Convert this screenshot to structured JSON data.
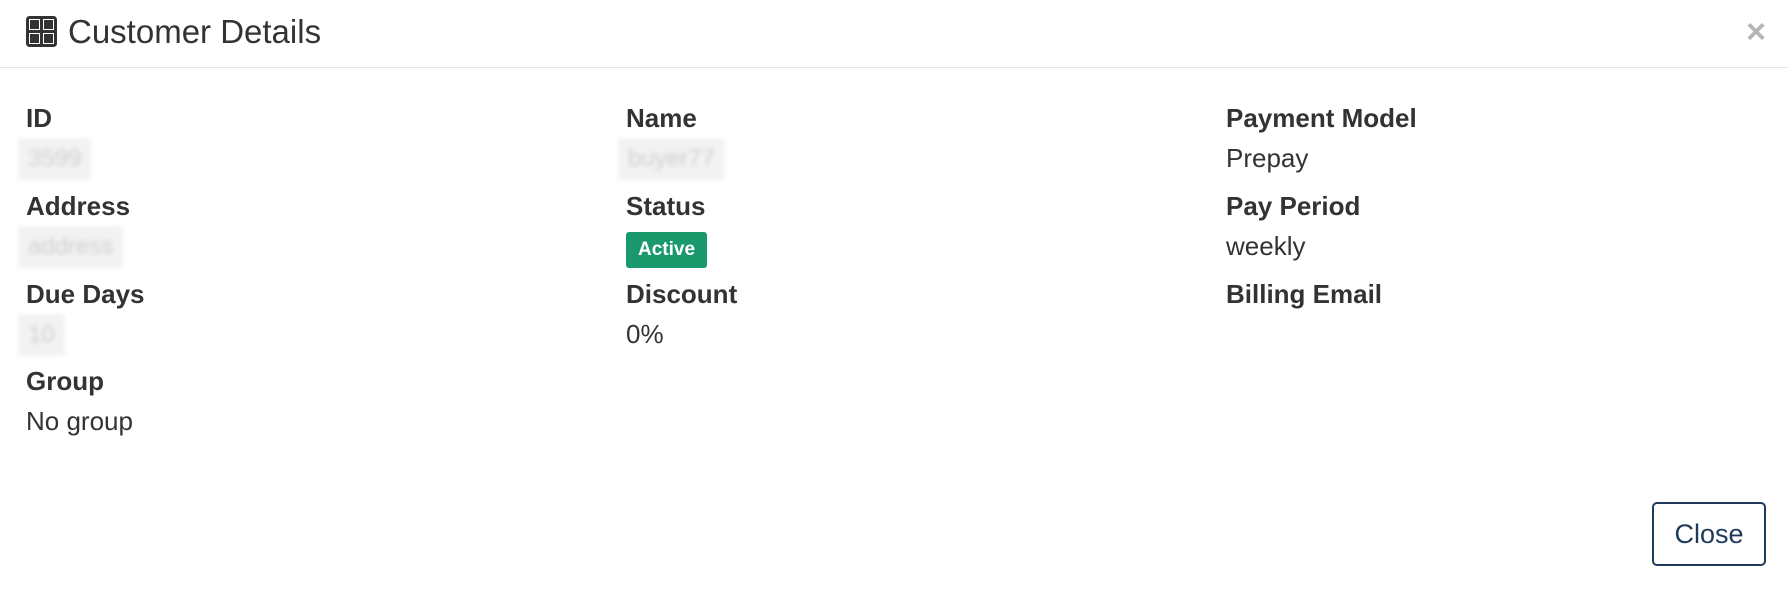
{
  "header": {
    "icon": "grid-icon",
    "title": "Customer Details",
    "close_glyph": "×"
  },
  "fields": {
    "id": {
      "label": "ID",
      "value": "3599"
    },
    "address": {
      "label": "Address",
      "value": "address"
    },
    "due_days": {
      "label": "Due Days",
      "value": "10"
    },
    "group": {
      "label": "Group",
      "value": "No group"
    },
    "name": {
      "label": "Name",
      "value": "buyer77"
    },
    "status": {
      "label": "Status",
      "value": "Active"
    },
    "discount": {
      "label": "Discount",
      "value": "0%"
    },
    "payment_model": {
      "label": "Payment Model",
      "value": "Prepay"
    },
    "pay_period": {
      "label": "Pay Period",
      "value": "weekly"
    },
    "billing_email": {
      "label": "Billing Email",
      "value": ""
    }
  },
  "footer": {
    "close_label": "Close"
  },
  "colors": {
    "status_active": "#1a9a6c",
    "button_border": "#1f3a5a"
  }
}
